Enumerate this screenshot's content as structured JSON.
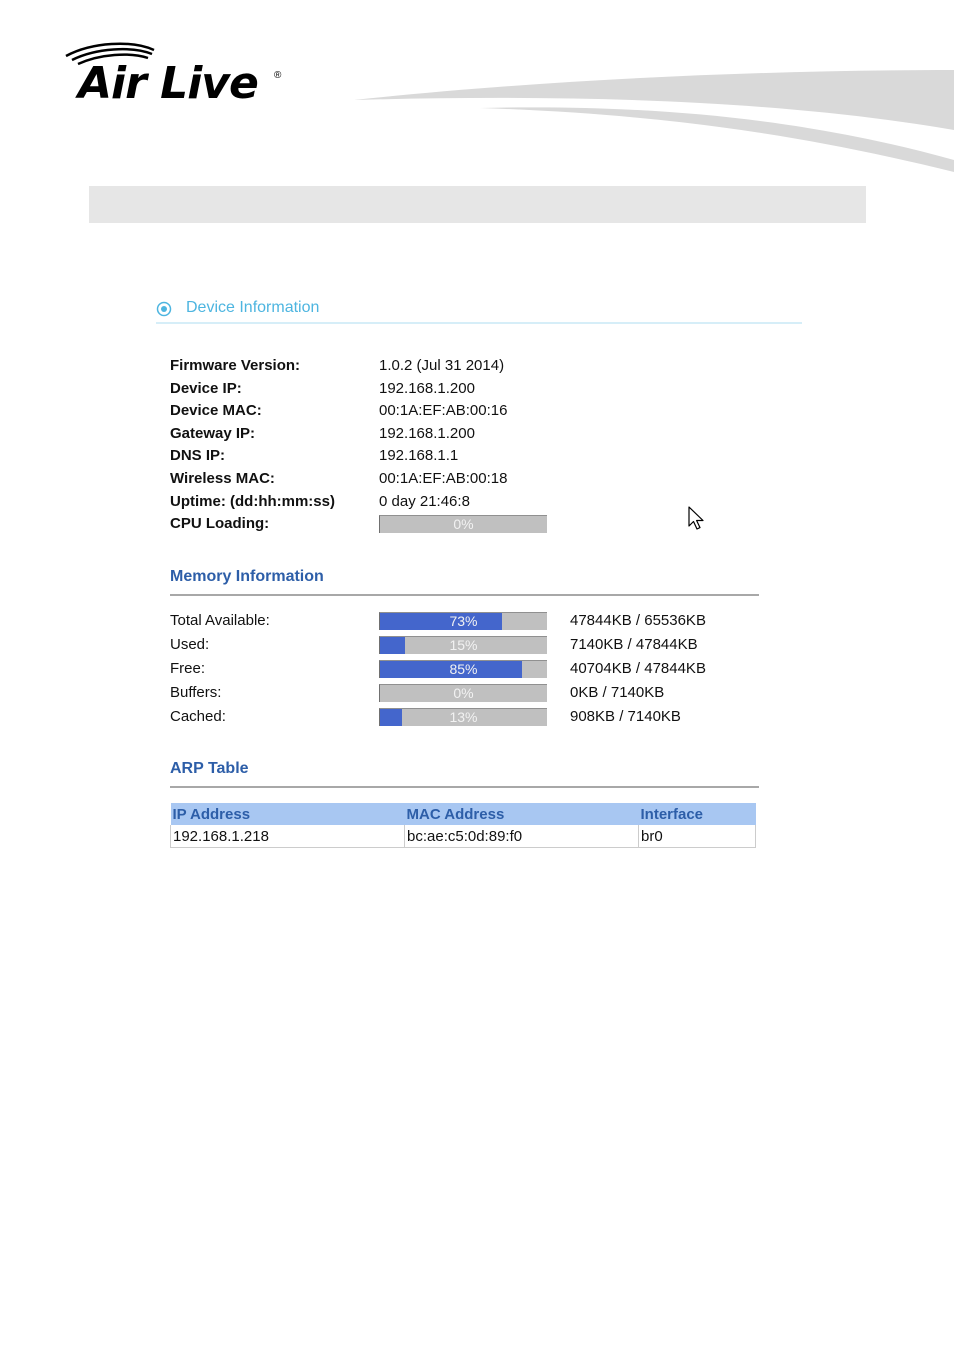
{
  "brand": {
    "logo_text": "Air Live",
    "registered_mark": "®"
  },
  "device_info": {
    "title": "Device Information",
    "rows": [
      {
        "label": "Firmware Version:",
        "value": "1.0.2 (Jul 31 2014)"
      },
      {
        "label": "Device IP:",
        "value": "192.168.1.200"
      },
      {
        "label": "Device MAC:",
        "value": "00:1A:EF:AB:00:16"
      },
      {
        "label": "Gateway IP:",
        "value": "192.168.1.200"
      },
      {
        "label": "DNS IP:",
        "value": "192.168.1.1"
      },
      {
        "label": "Wireless MAC:",
        "value": "00:1A:EF:AB:00:18"
      },
      {
        "label": "Uptime: (dd:hh:mm:ss)",
        "value": "0 day 21:46:8"
      }
    ],
    "cpu": {
      "label": "CPU Loading:",
      "percent": 0,
      "percent_text": "0%"
    }
  },
  "memory": {
    "title": "Memory Information",
    "rows": [
      {
        "label": "Total Available:",
        "percent": 73,
        "percent_text": "73%",
        "amount": "47844KB / 65536KB"
      },
      {
        "label": "Used:",
        "percent": 15,
        "percent_text": "15%",
        "amount": "7140KB / 47844KB"
      },
      {
        "label": "Free:",
        "percent": 85,
        "percent_text": "85%",
        "amount": "40704KB / 47844KB"
      },
      {
        "label": "Buffers:",
        "percent": 0,
        "percent_text": "0%",
        "amount": "0KB / 7140KB"
      },
      {
        "label": "Cached:",
        "percent": 13,
        "percent_text": "13%",
        "amount": "908KB / 7140KB"
      }
    ]
  },
  "arp": {
    "title": "ARP Table",
    "headers": [
      "IP Address",
      "MAC Address",
      "Interface"
    ],
    "rows": [
      [
        "192.168.1.218",
        "bc:ae:c5:0d:89:f0",
        "br0"
      ]
    ]
  },
  "icons": {
    "section_icon": "ring-icon",
    "pointer": "mouse-pointer-icon"
  },
  "colors": {
    "accent_title": "#4db5e0",
    "subheading": "#2d5ea8",
    "bar_fill": "#4466cc",
    "bar_track": "#c0c0c0",
    "table_header": "#a8c7f2",
    "header_bar": "#e6e6e6"
  }
}
